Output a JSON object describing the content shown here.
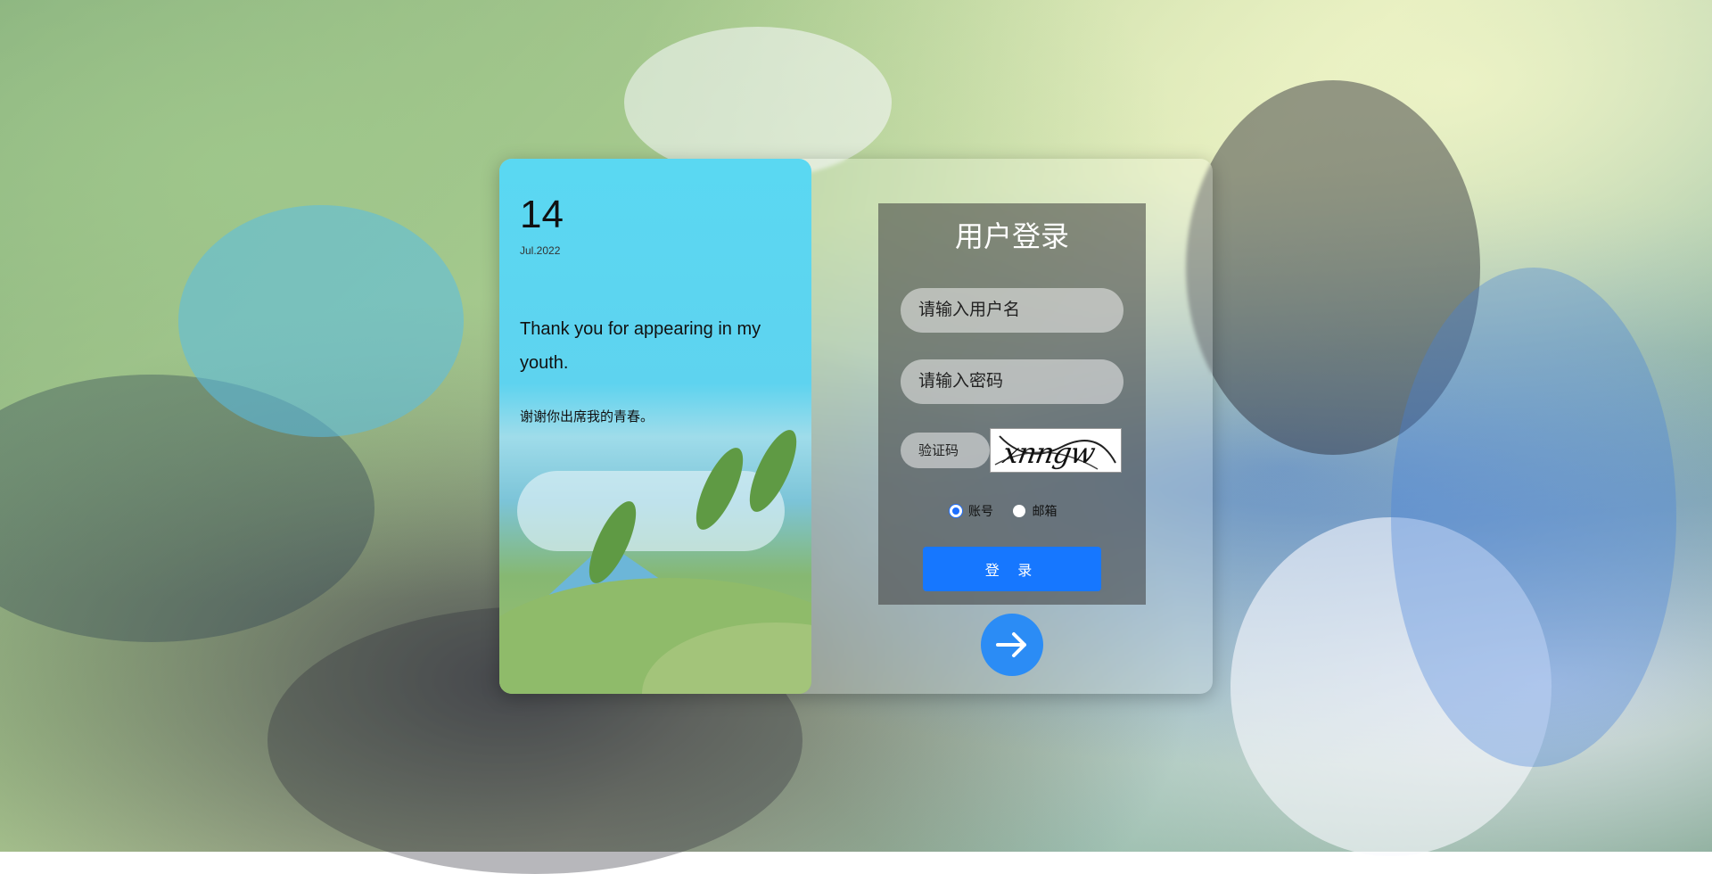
{
  "background": {
    "icon": "anime-illustration-background"
  },
  "intro_card": {
    "day": "14",
    "month_year": "Jul.2022",
    "quote_en": "Thank you for appearing in my youth.",
    "quote_cn": "谢谢你出席我的青春。"
  },
  "login_form": {
    "title": "用户登录",
    "username_placeholder": "请输入用户名",
    "password_placeholder": "请输入密码",
    "captcha_placeholder": "验证码",
    "captcha_text": "xnngw",
    "login_types": [
      {
        "label": "账号",
        "selected": true
      },
      {
        "label": "邮箱",
        "selected": false
      }
    ],
    "submit_label": "登 录",
    "accent_color": "#1677ff"
  },
  "next_button": {
    "icon": "arrow-right-icon"
  }
}
